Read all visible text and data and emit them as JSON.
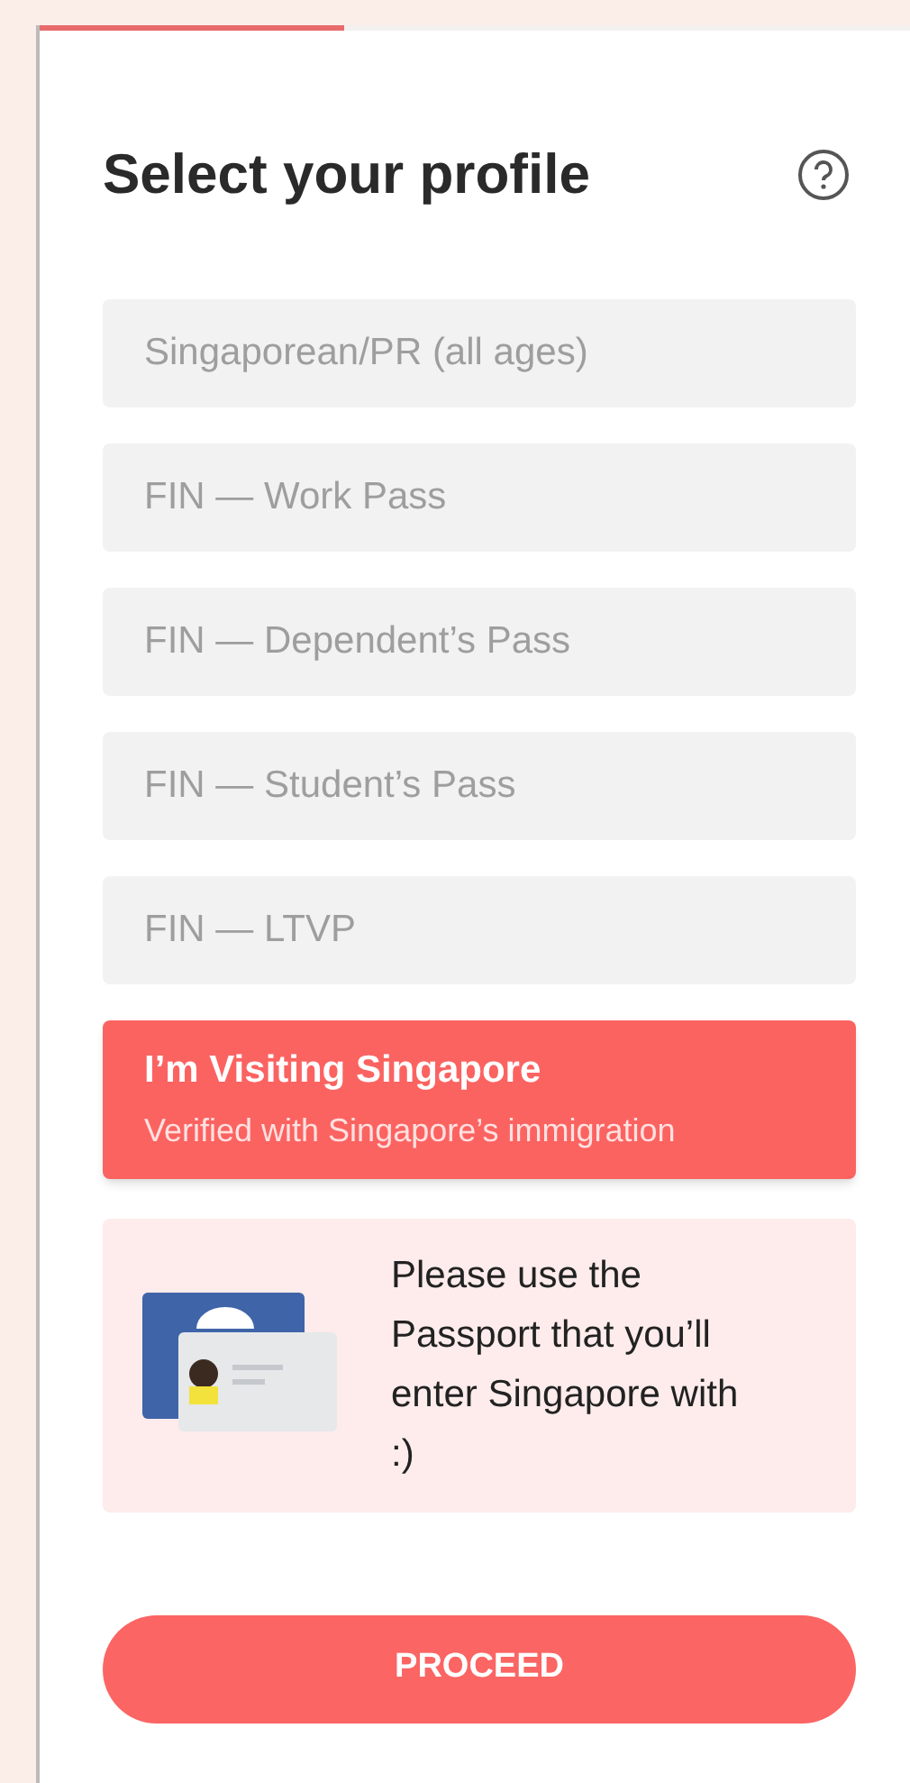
{
  "progress": {
    "level": 0.35
  },
  "title": "Select your profile",
  "profiles": [
    {
      "label": "Singaporean/PR (all ages)",
      "selected": false
    },
    {
      "label": "FIN — Work Pass",
      "selected": false
    },
    {
      "label": "FIN — Dependent’s Pass",
      "selected": false
    },
    {
      "label": "FIN — Student’s Pass",
      "selected": false
    },
    {
      "label": "FIN — LTVP",
      "selected": false
    },
    {
      "label": "I’m Visiting Singapore",
      "subtitle": "Verified with Singapore’s immigration",
      "selected": true
    }
  ],
  "notice": {
    "text": "Please use the Passport that you’ll enter Singapore with :)"
  },
  "button": "PROCEED"
}
